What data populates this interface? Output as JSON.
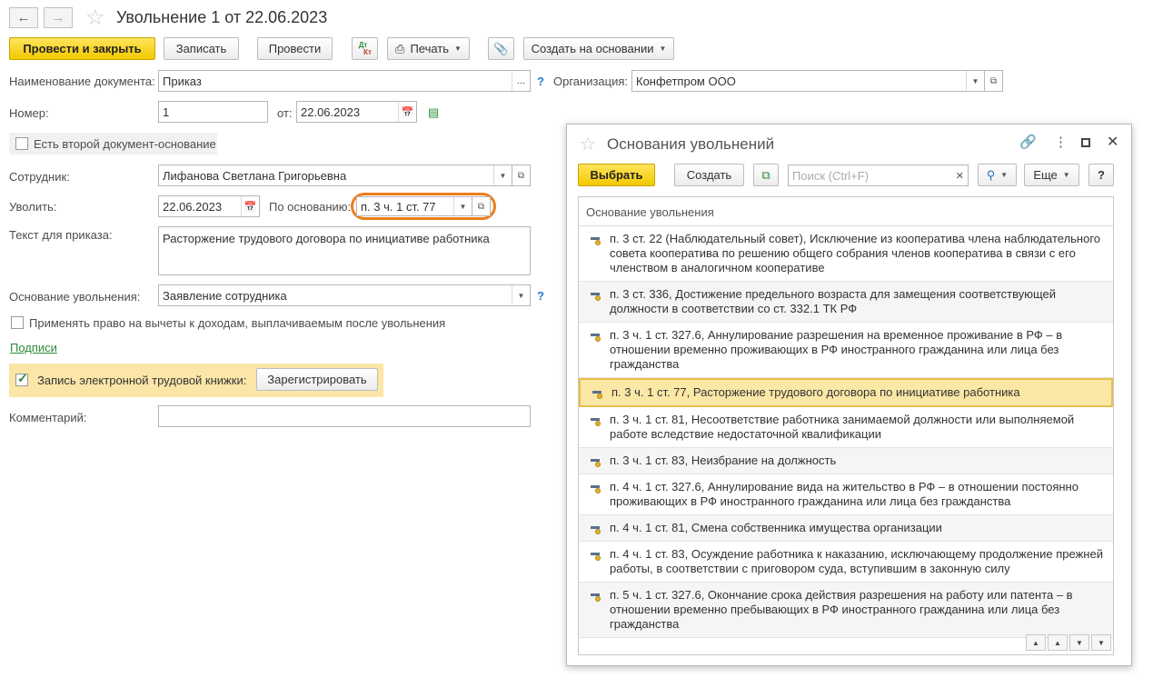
{
  "window": {
    "title": "Увольнение 1 от 22.06.2023"
  },
  "toolbar": {
    "post_close": "Провести и закрыть",
    "write": "Записать",
    "post": "Провести",
    "dtkt_top": "Дт",
    "dtkt_bottom": "Кт",
    "print": "Печать",
    "create_based": "Создать на основании"
  },
  "form": {
    "doc_name_label": "Наименование документа:",
    "doc_name_value": "Приказ",
    "org_label": "Организация:",
    "org_value": "Конфетпром ООО",
    "number_label": "Номер:",
    "number_value": "1",
    "from_label": "от:",
    "date_value": "22.06.2023",
    "second_doc_label": "Есть второй документ-основание",
    "employee_label": "Сотрудник:",
    "employee_value": "Лифанова Светлана Григорьевна",
    "dismiss_label": "Уволить:",
    "dismiss_date": "22.06.2023",
    "basis_label": "По основанию:",
    "basis_value": "п. 3 ч. 1 ст. 77",
    "order_text_label": "Текст для приказа:",
    "order_text_value": "Расторжение трудового договора по инициативе работника",
    "reason_label": "Основание увольнения:",
    "reason_value": "Заявление сотрудника",
    "deductions_label": "Применять право на вычеты к доходам, выплачиваемым после увольнения",
    "signatures_link": "Подписи",
    "etk_label": "Запись электронной трудовой книжки:",
    "register_button": "Зарегистрировать",
    "comment_label": "Комментарий:",
    "comment_value": "",
    "help": "?"
  },
  "dialog": {
    "title": "Основания увольнений",
    "select": "Выбрать",
    "create": "Создать",
    "search_placeholder": "Поиск (Ctrl+F)",
    "more": "Еще",
    "help": "?",
    "column_header": "Основание увольнения",
    "rows": [
      {
        "text": "п. 3 ст. 22 (Наблюдательный совет), Исключение из кооператива члена наблюдательного совета кооператива по решению общего собрания членов кооператива в связи с его членством в аналогичном кооперативе"
      },
      {
        "text": "п. 3 ст. 336, Достижение предельного возраста для замещения соответствующей должности в соответствии со ст. 332.1 ТК РФ"
      },
      {
        "text": "п. 3 ч. 1 ст. 327.6, Аннулирование разрешения на временное проживание в РФ – в отношении временно проживающих в РФ иностранного гражданина или лица без гражданства"
      },
      {
        "text": "п. 3 ч. 1 ст. 77, Расторжение трудового договора по инициативе работника"
      },
      {
        "text": "п. 3 ч. 1 ст. 81, Несоответствие работника занимаемой должности или выполняемой работе вследствие недостаточной квалификации"
      },
      {
        "text": "п. 3 ч. 1 ст. 83, Неизбрание на должность"
      },
      {
        "text": "п. 4 ч. 1 ст. 327.6, Аннулирование вида на жительство в РФ – в отношении постоянно проживающих в РФ иностранного гражданина или лица без гражданства"
      },
      {
        "text": "п. 4 ч. 1 ст. 81, Смена собственника имущества организации"
      },
      {
        "text": "п. 4 ч. 1 ст. 83, Осуждение работника к наказанию, исключающему продолжение прежней работы, в соответствии с приговором суда, вступившим в законную силу"
      },
      {
        "text": "п. 5 ч. 1 ст. 327.6, Окончание срока действия разрешения на работу или патента – в отношении временно пребывающих в РФ иностранного гражданина или лица без гражданства"
      }
    ],
    "selected_index": 3
  },
  "colors": {
    "accent": "#f3c900",
    "highlight": "#ee7d1c",
    "link": "#2a8a3a",
    "selected_row": "#fbe7a6"
  }
}
